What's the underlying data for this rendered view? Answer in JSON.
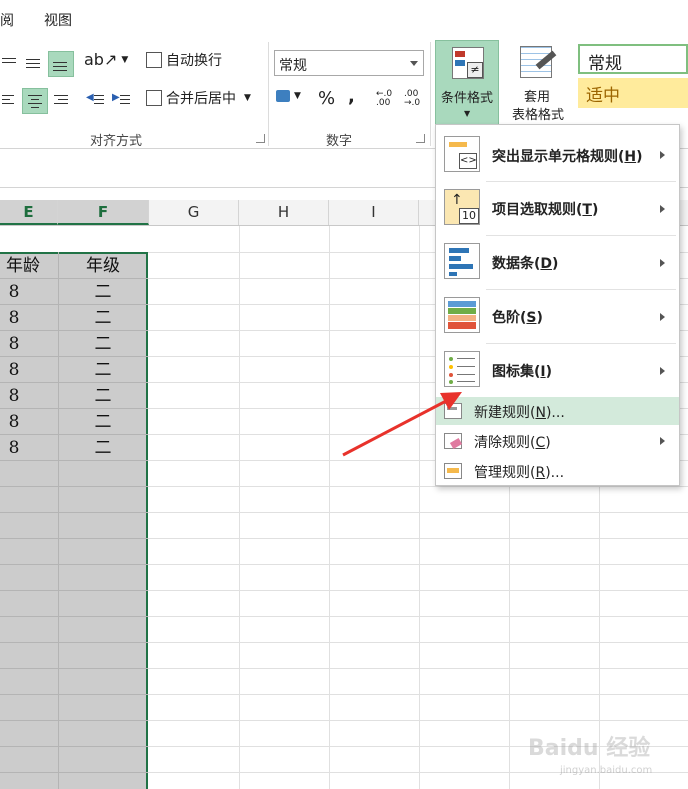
{
  "tabs": [
    {
      "label": "阅"
    },
    {
      "label": "视图"
    }
  ],
  "ribbon": {
    "alignment": {
      "wrap_text": "自动换行",
      "merge_center": "合并后居中",
      "group_label": "对齐方式"
    },
    "number": {
      "format_value": "常规",
      "percent": "%",
      "comma": ",",
      "inc_decimal": "←.0 .00",
      "dec_decimal": ".00 →.0",
      "group_label": "数字"
    },
    "conditional_format": "条件格式",
    "table_format_line1": "套用",
    "table_format_line2": "表格格式",
    "styles": {
      "normal": "常规",
      "neutral": "适中",
      "normal_border": "#7fbf7f",
      "neutral_bg": "#ffeb9c",
      "neutral_color": "#9c6500"
    }
  },
  "columns": [
    "E",
    "F",
    "G",
    "H",
    "I"
  ],
  "table": {
    "headers": [
      "年龄",
      "年级"
    ],
    "header_e_display": "年龄",
    "rows": [
      {
        "age": "8",
        "grade": "二"
      },
      {
        "age": "8",
        "grade": "二"
      },
      {
        "age": "8",
        "grade": "二"
      },
      {
        "age": "8",
        "grade": "二"
      },
      {
        "age": "8",
        "grade": "二"
      },
      {
        "age": "8",
        "grade": "二"
      },
      {
        "age": "8",
        "grade": "二"
      }
    ]
  },
  "menu": {
    "highlight_rules": {
      "text": "突出显示单元格规则(",
      "key": "H",
      "tail": ")"
    },
    "top_bottom_rules": {
      "text": "项目选取规则(",
      "key": "T",
      "tail": ")"
    },
    "data_bars": {
      "text": "数据条(",
      "key": "D",
      "tail": ")"
    },
    "color_scales": {
      "text": "色阶(",
      "key": "S",
      "tail": ")"
    },
    "icon_sets": {
      "text": "图标集(",
      "key": "I",
      "tail": ")"
    },
    "new_rule": {
      "text": "新建规则(",
      "key": "N",
      "tail": ")..."
    },
    "clear_rules": {
      "text": "清除规则(",
      "key": "C",
      "tail": ")"
    },
    "manage_rules": {
      "text": "管理规则(",
      "key": "R",
      "tail": ")..."
    },
    "hover_color": "#d3eadb"
  },
  "watermark": {
    "line1": "Baidu 经验",
    "line2": "jingyan.baidu.com"
  },
  "accent": "#217346"
}
